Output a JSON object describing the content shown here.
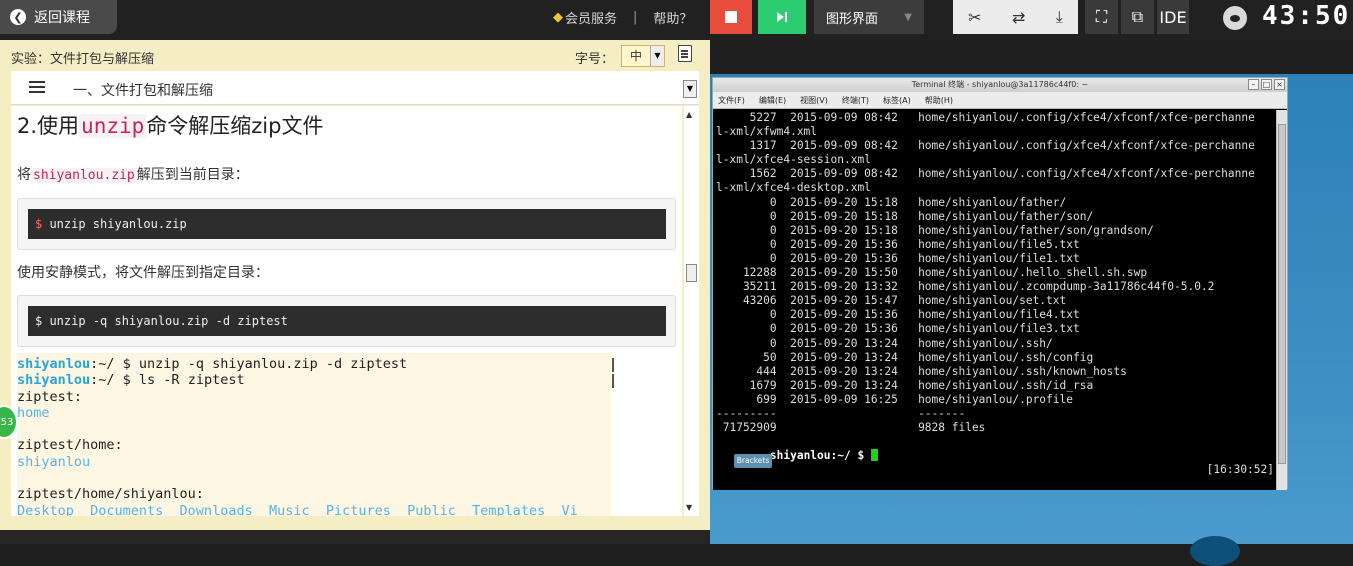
{
  "topbar": {
    "back_label": "返回课程",
    "vip_label": "会员服务",
    "sep": "|",
    "help_label": "帮助？",
    "mode_label": "图形界面",
    "ide_label": "IDE",
    "timer": "43:50"
  },
  "lesson": {
    "experiment_title": "实验：文件打包与解压缩",
    "fontsize_label": "字号：",
    "fontsize_value": "中",
    "toc_title": "一、文件打包和解压缩",
    "heading_prefix": "2.使用",
    "heading_code": "unzip",
    "heading_suffix": "命令解压缩zip文件",
    "p1_prefix": "将",
    "p1_code": "shiyanlou.zip",
    "p1_suffix": "解压到当前目录：",
    "code1_dollar": "$",
    "code1_cmd": " unzip shiyanlou.zip",
    "p2": "使用安静模式，将文件解压到指定目录：",
    "code2": "$ unzip -q shiyanlou.zip -d ziptest",
    "badge": "53"
  },
  "lesson_terminal": {
    "lines": [
      {
        "user": "shiyanlou",
        "rest": ":~/ $ unzip -q shiyanlou.zip -d ziptest"
      },
      {
        "user": "shiyanlou",
        "rest": ":~/ $ ls -R ziptest"
      },
      {
        "text": "ziptest:"
      },
      {
        "dir": "home"
      },
      {
        "text": ""
      },
      {
        "text": "ziptest/home:"
      },
      {
        "dir": "shiyanlou"
      },
      {
        "text": ""
      },
      {
        "text": "ziptest/home/shiyanlou:"
      },
      {
        "dir": "Desktop  Documents  Downloads  Music  Pictures  Public  Templates  Vi"
      }
    ]
  },
  "terminal_window": {
    "title": "Terminal 终端 - shiyanlou@3a11786c44f0: ~",
    "menu": [
      "文件(F)",
      "编辑(E)",
      "视图(V)",
      "终端(T)",
      "标签(A)",
      "帮助(H)"
    ],
    "lines": [
      "     5227  2015-09-09 08:42   home/shiyanlou/.config/xfce4/xfconf/xfce-perchanne",
      "l-xml/xfwm4.xml",
      "     1317  2015-09-09 08:42   home/shiyanlou/.config/xfce4/xfconf/xfce-perchanne",
      "l-xml/xfce4-session.xml",
      "     1562  2015-09-09 08:42   home/shiyanlou/.config/xfce4/xfconf/xfce-perchanne",
      "l-xml/xfce4-desktop.xml",
      "        0  2015-09-20 15:18   home/shiyanlou/father/",
      "        0  2015-09-20 15:18   home/shiyanlou/father/son/",
      "        0  2015-09-20 15:18   home/shiyanlou/father/son/grandson/",
      "        0  2015-09-20 15:36   home/shiyanlou/file5.txt",
      "        0  2015-09-20 15:36   home/shiyanlou/file1.txt",
      "    12288  2015-09-20 15:50   home/shiyanlou/.hello_shell.sh.swp",
      "    35211  2015-09-20 13:32   home/shiyanlou/.zcompdump-3a11786c44f0-5.0.2",
      "    43206  2015-09-20 15:47   home/shiyanlou/set.txt",
      "        0  2015-09-20 15:36   home/shiyanlou/file4.txt",
      "        0  2015-09-20 15:36   home/shiyanlou/file3.txt",
      "        0  2015-09-20 13:24   home/shiyanlou/.ssh/",
      "       50  2015-09-20 13:24   home/shiyanlou/.ssh/config",
      "      444  2015-09-20 13:24   home/shiyanlou/.ssh/known_hosts",
      "     1679  2015-09-20 13:24   home/shiyanlou/.ssh/id_rsa",
      "      699  2015-09-09 16:25   home/shiyanlou/.profile",
      "---------                     -------",
      " 71752909                     9828 files"
    ],
    "prompt": "shiyanlou:~/ $ ",
    "clock": "[16:30:52]"
  },
  "desktop": {
    "brackets_label": "Brackets"
  }
}
